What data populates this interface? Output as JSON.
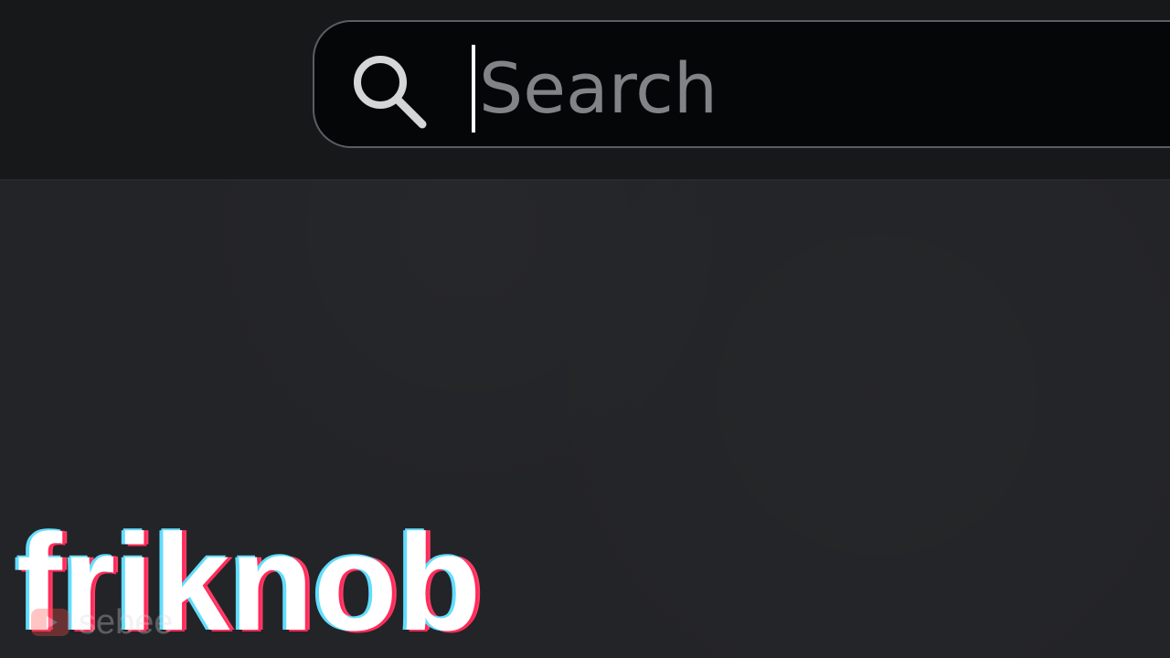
{
  "search": {
    "placeholder": "Search",
    "value": ""
  },
  "icons": {
    "search": "search-icon",
    "youtube": "youtube-icon"
  },
  "overlay": {
    "title": "friknob",
    "watermark": "sebee"
  },
  "colors": {
    "background": "#232427",
    "top_bar": "#17181a",
    "search_background": "#050608",
    "search_border": "#5b5d63",
    "placeholder": "#828387",
    "title": "#ffffff"
  }
}
